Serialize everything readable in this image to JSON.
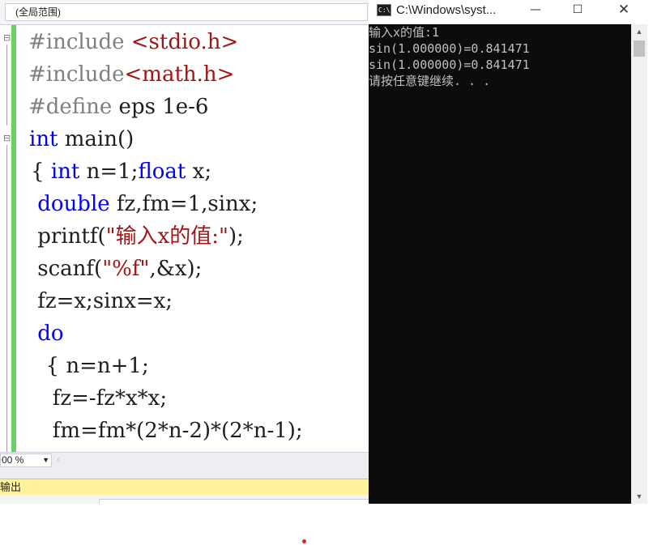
{
  "editor": {
    "scope_dropdown": "(全局范围)",
    "zoom": "00 %",
    "output_tab": "输出",
    "code_lines": [
      [
        {
          "t": "#include ",
          "c": "pre"
        },
        {
          "t": "<stdio.h>",
          "c": "str"
        }
      ],
      [
        {
          "t": "#include",
          "c": "pre"
        },
        {
          "t": "<math.h>",
          "c": "str"
        }
      ],
      [
        {
          "t": "#define",
          "c": "pre"
        },
        {
          "t": " eps 1e-6",
          "c": ""
        }
      ],
      [
        {
          "t": "int",
          "c": "kw"
        },
        {
          "t": " main()",
          "c": ""
        }
      ],
      [
        {
          "t": "{ ",
          "c": ""
        },
        {
          "t": "int",
          "c": "kw"
        },
        {
          "t": " n=1;",
          "c": ""
        },
        {
          "t": "float",
          "c": "kw"
        },
        {
          "t": " x;",
          "c": ""
        }
      ],
      [
        {
          "t": " ",
          "c": ""
        },
        {
          "t": "double",
          "c": "kw"
        },
        {
          "t": " fz,fm=1,sinx;",
          "c": ""
        }
      ],
      [
        {
          "t": " printf(",
          "c": ""
        },
        {
          "t": "\"输入x的值:\"",
          "c": "str"
        },
        {
          "t": ");",
          "c": ""
        }
      ],
      [
        {
          "t": " scanf(",
          "c": ""
        },
        {
          "t": "\"%f\"",
          "c": "str"
        },
        {
          "t": ",&x);",
          "c": ""
        }
      ],
      [
        {
          "t": " fz=x;sinx=x;",
          "c": ""
        }
      ],
      [
        {
          "t": " ",
          "c": ""
        },
        {
          "t": "do",
          "c": "kw"
        }
      ],
      [
        {
          "t": "  { n=n+1;",
          "c": ""
        }
      ],
      [
        {
          "t": "   fz=-fz*x*x;",
          "c": ""
        }
      ],
      [
        {
          "t": "   fm=fm*(2*n-2)*(2*n-1);",
          "c": ""
        }
      ]
    ]
  },
  "console": {
    "title": "C:\\Windows\\syst...",
    "icon_label": "C:\\.",
    "buttons": {
      "minimize": "—",
      "maximize": "☐",
      "close": "✕"
    },
    "lines": [
      "输入x的值:1",
      "sin(1.000000)=0.841471",
      "sin(1.000000)=0.841471",
      "请按任意键继续. . ."
    ]
  },
  "colors": {
    "keyword": "#0000ff",
    "preprocessor": "#808080",
    "string": "#a31515",
    "change_bar": "#6ccf62",
    "output_tab": "#fff29d",
    "console_bg": "#0c0c0c",
    "console_text": "#c0c0c0"
  }
}
